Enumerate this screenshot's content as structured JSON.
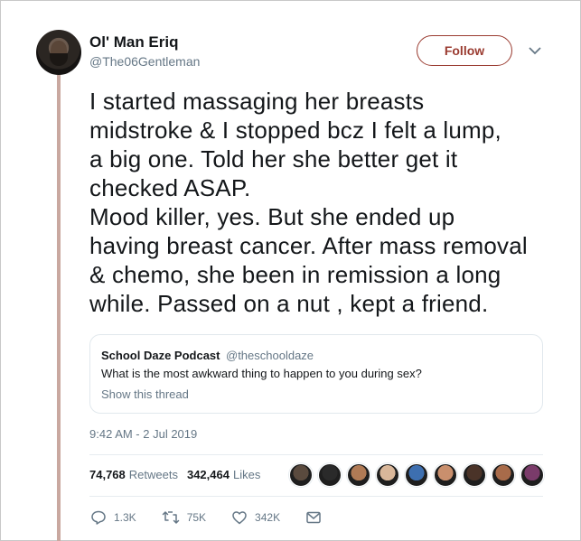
{
  "author": {
    "display_name": "Ol' Man Eriq",
    "handle": "@The06Gentleman"
  },
  "follow_label": "Follow",
  "tweet_text": "I started massaging her breasts\nmidstroke & I stopped bcz I felt a lump,\na big one. Told her she better get it\nchecked ASAP.\nMood killer, yes. But she ended up\nhaving breast cancer. After mass removal\n& chemo, she been in remission a long\nwhile. Passed on a nut , kept a friend.",
  "quote": {
    "name": "School Daze Podcast",
    "handle": "@theschooldaze",
    "text": "What is the most awkward thing to happen to you during sex?",
    "link": "Show this thread"
  },
  "timestamp": "9:42 AM - 2 Jul 2019",
  "stats": {
    "retweets_count": "74,768",
    "retweets_label": "Retweets",
    "likes_count": "342,464",
    "likes_label": "Likes"
  },
  "likers_colors": [
    "#5a4a3e",
    "#2a2a2a",
    "#b07a55",
    "#d9b79a",
    "#3d6fb0",
    "#c98f6d",
    "#4a3328",
    "#a86b4a",
    "#7a3b6a"
  ],
  "actions": {
    "replies": "1.3K",
    "retweets": "75K",
    "likes": "342K"
  },
  "colors": {
    "accent": "#9a3b30",
    "thread_line": "#c9a8a0",
    "secondary_text": "#657786"
  }
}
